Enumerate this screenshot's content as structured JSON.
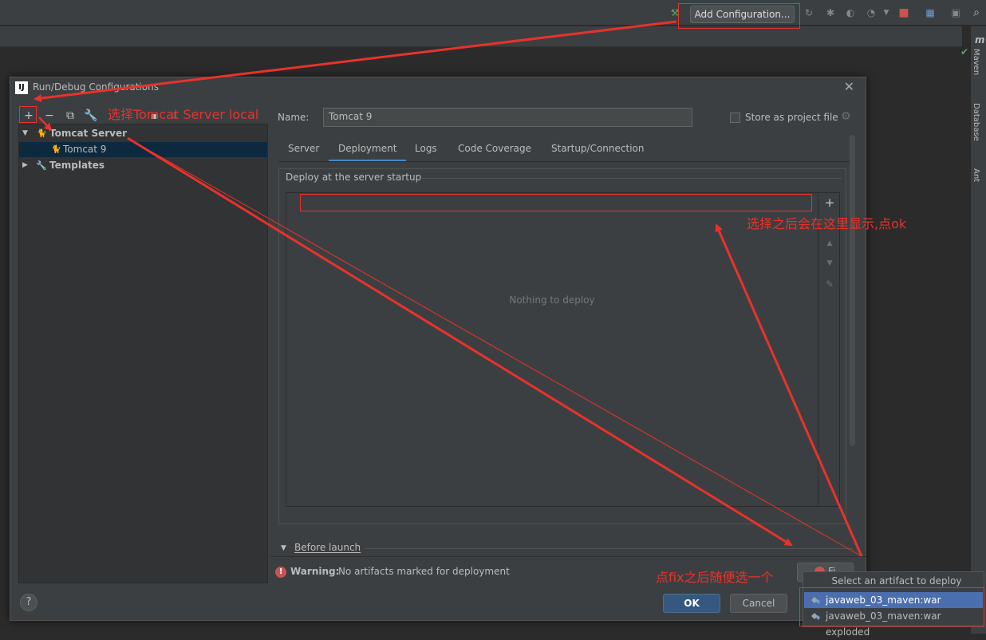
{
  "toolbar": {
    "add_configuration": "Add Configuration..."
  },
  "right_panel": {
    "tabs": [
      "Maven",
      "Database",
      "Ant"
    ]
  },
  "dialog": {
    "title": "Run/Debug Configurations",
    "tree": {
      "tomcat_server": "Tomcat Server",
      "tomcat_9": "Tomcat 9",
      "templates": "Templates"
    },
    "name_label": "Name:",
    "name_value": "Tomcat 9",
    "store_as_project_file": "Store as project file",
    "tabs": [
      "Server",
      "Deployment",
      "Logs",
      "Code Coverage",
      "Startup/Connection"
    ],
    "active_tab": "Deployment",
    "deploy_group_title": "Deploy at the server startup",
    "nothing_to_deploy": "Nothing to deploy",
    "before_launch": "Before launch",
    "warning_label": "Warning:",
    "warning_text": "No artifacts marked for deployment",
    "fix_button": "Fi",
    "ok_button": "OK",
    "cancel_button": "Cancel",
    "help_button": "?"
  },
  "popup": {
    "title": "Select an artifact to deploy",
    "items": [
      "javaweb_03_maven:war",
      "javaweb_03_maven:war exploded"
    ]
  },
  "annotations": {
    "select_tomcat": "选择Tomcat Server local",
    "show_here": "选择之后会在这里显示,点ok",
    "click_fix": "点fix之后随便选一个"
  },
  "colors": {
    "accent": "#4a88c7",
    "selection": "#0d293e",
    "popup_selection": "#4b6eaf",
    "annotation": "#e8322c",
    "error": "#c75450"
  }
}
